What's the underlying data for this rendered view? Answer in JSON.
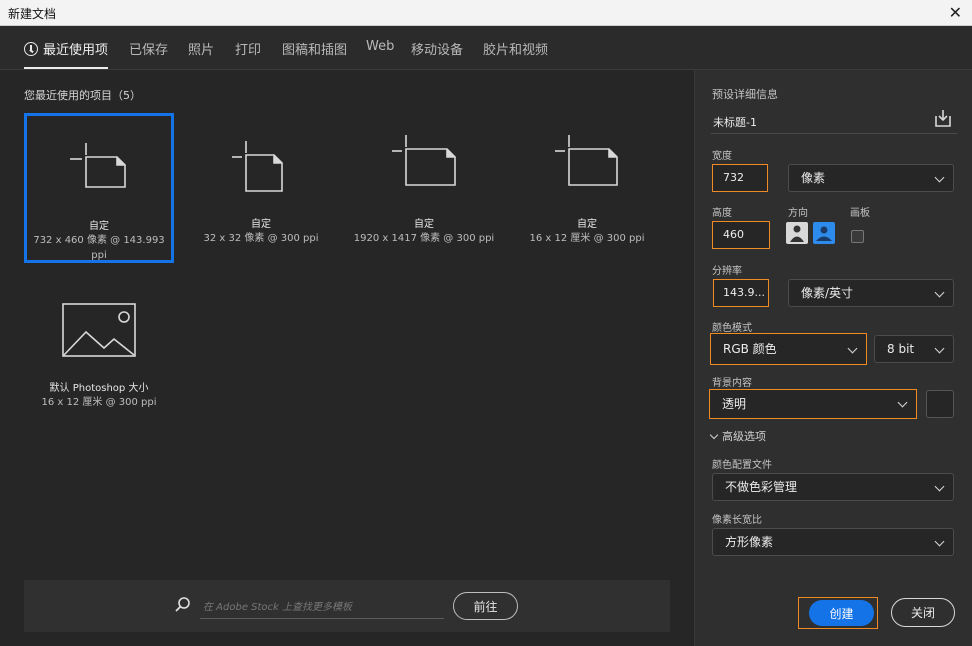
{
  "window": {
    "title": "新建文档",
    "close_symbol": "✕"
  },
  "tabs": [
    {
      "label": "最近使用项",
      "active": true,
      "icon": "clock-icon"
    },
    {
      "label": "已保存"
    },
    {
      "label": "照片"
    },
    {
      "label": "打印"
    },
    {
      "label": "图稿和插图"
    },
    {
      "label": "Web"
    },
    {
      "label": "移动设备"
    },
    {
      "label": "胶片和视频"
    }
  ],
  "recent": {
    "title": "您最近使用的项目（5）",
    "items": [
      {
        "name": "自定",
        "desc": "732 x 460 像素 @ 143.993 ppi",
        "selected": true,
        "icon": "document-icon"
      },
      {
        "name": "自定",
        "desc": "32 x 32 像素 @ 300 ppi",
        "icon": "document-icon"
      },
      {
        "name": "自定",
        "desc": "1920 x 1417 像素 @ 300 ppi",
        "icon": "document-icon"
      },
      {
        "name": "自定",
        "desc": "16 x 12 厘米 @ 300 ppi",
        "icon": "document-icon"
      },
      {
        "name": "默认 Photoshop 大小",
        "desc": "16 x 12 厘米 @ 300 ppi",
        "icon": "image-placeholder-icon"
      }
    ]
  },
  "stock": {
    "placeholder": "在 Adobe Stock 上查找更多模板",
    "go_label": "前往",
    "icon": "search-icon"
  },
  "details": {
    "header": "预设详细信息",
    "doc_name": "未标题-1",
    "save_icon": "save-preset-icon",
    "width_label": "宽度",
    "width_value": "732",
    "width_unit": "像素",
    "height_label": "高度",
    "height_value": "460",
    "orientation_label": "方向",
    "artboard_label": "画板",
    "resolution_label": "分辨率",
    "resolution_value": "143.9...",
    "resolution_unit": "像素/英寸",
    "color_mode_label": "颜色模式",
    "color_mode": "RGB 颜色",
    "bit_depth": "8 bit",
    "background_label": "背景内容",
    "background": "透明",
    "advanced_label": "高级选项",
    "color_profile_label": "颜色配置文件",
    "color_profile": "不做色彩管理",
    "pixel_aspect_label": "像素长宽比",
    "pixel_aspect": "方形像素"
  },
  "actions": {
    "create": "创建",
    "close": "关闭"
  },
  "colors": {
    "accent": "#1473e6",
    "highlight": "#f08a24",
    "panel": "#2f2f2f",
    "bg": "#262626"
  }
}
